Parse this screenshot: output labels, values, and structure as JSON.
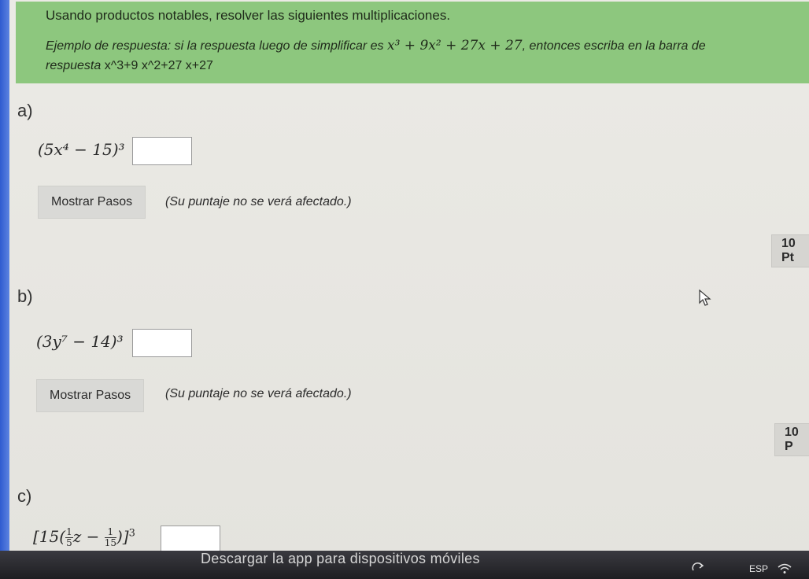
{
  "instructions": {
    "title": "Usando productos notables, resolver las siguientes multiplicaciones.",
    "example_prefix": "Ejemplo de respuesta: si la respuesta luego de simplificar es ",
    "example_math": "x³ + 9x² + 27x + 27",
    "example_suffix": ", entonces escriba en la barra de",
    "example_line2_prefix": "respuesta ",
    "example_answer": "x^3+9 x^2+27 x+27"
  },
  "parts": [
    {
      "label": "a)",
      "expression": "(5x⁴ − 15)³",
      "steps_button": "Mostrar Pasos",
      "steps_note": "(Su puntaje no se verá afectado.)",
      "points": "10 Pt"
    },
    {
      "label": "b)",
      "expression": "(3y⁷ − 14)³",
      "steps_button": "Mostrar Pasos",
      "steps_note": "(Su puntaje no se verá afectado.)",
      "points": "10 P"
    },
    {
      "label": "c)",
      "expression_prefix": "[15(",
      "frac1_num": "1",
      "frac1_den": "5",
      "expression_mid": "z − ",
      "frac2_num": "1",
      "frac2_den": "15",
      "expression_suffix": ")]",
      "expression_power": "3"
    }
  ],
  "footer": {
    "banner": "Descargar la app para dispositivos móviles",
    "language": "ESP"
  },
  "icons": {
    "cursor": "mouse-pointer-icon",
    "wifi": "wifi-icon",
    "redo": "redo-icon"
  }
}
